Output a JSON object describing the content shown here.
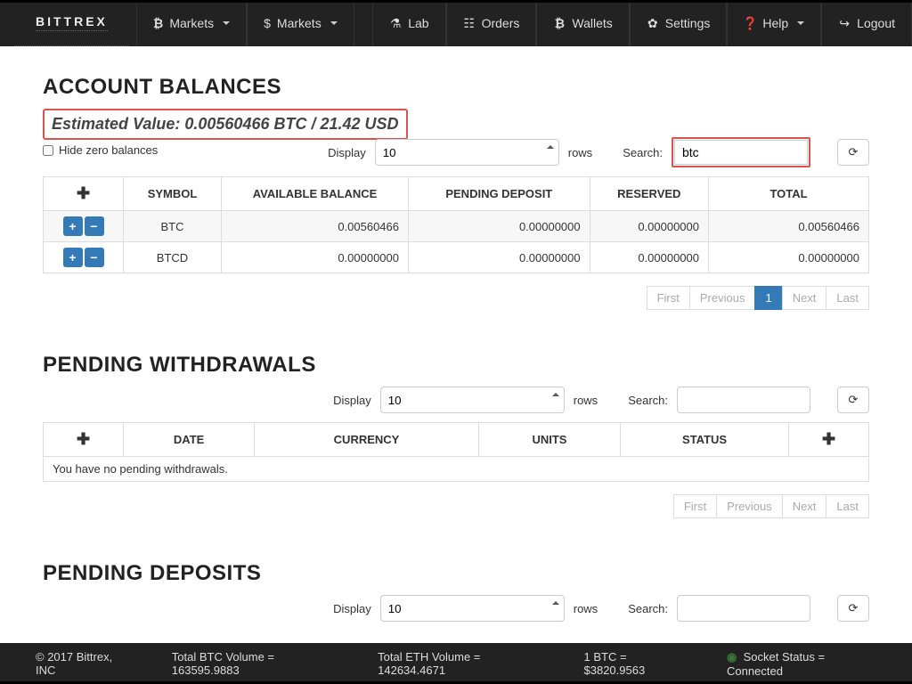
{
  "nav": {
    "brand": "BITTREX",
    "bmarkets": "₿ Markets",
    "dmarkets": "$ Markets",
    "lab": "Lab",
    "orders": "Orders",
    "wallets": "Wallets",
    "settings": "Settings",
    "help": "Help",
    "logout": "Logout"
  },
  "balances": {
    "title": "ACCOUNT BALANCES",
    "estimated": "Estimated Value: 0.00560466 BTC / 21.42 USD",
    "hidezero": "Hide zero balances",
    "display_label": "Display",
    "display_value": "10",
    "rows_label": "rows",
    "search_label": "Search:",
    "search_value": "btc",
    "headers": {
      "plus": "✚",
      "symbol": "SYMBOL",
      "avail": "AVAILABLE BALANCE",
      "pending": "PENDING DEPOSIT",
      "reserved": "RESERVED",
      "total": "TOTAL"
    },
    "rows": [
      {
        "symbol": "BTC",
        "avail": "0.00560466",
        "pending": "0.00000000",
        "reserved": "0.00000000",
        "total": "0.00560466"
      },
      {
        "symbol": "BTCD",
        "avail": "0.00000000",
        "pending": "0.00000000",
        "reserved": "0.00000000",
        "total": "0.00000000"
      }
    ],
    "pager": {
      "first": "First",
      "prev": "Previous",
      "page": "1",
      "next": "Next",
      "last": "Last"
    }
  },
  "withdrawals": {
    "title": "PENDING WITHDRAWALS",
    "display_label": "Display",
    "display_value": "10",
    "rows_label": "rows",
    "search_label": "Search:",
    "search_value": "",
    "headers": {
      "plus": "✚",
      "date": "DATE",
      "currency": "CURRENCY",
      "units": "UNITS",
      "status": "STATUS",
      "plus2": "✚"
    },
    "empty": "You have no pending withdrawals.",
    "pager": {
      "first": "First",
      "prev": "Previous",
      "next": "Next",
      "last": "Last"
    }
  },
  "deposits": {
    "title": "PENDING DEPOSITS",
    "display_label": "Display",
    "display_value": "10",
    "rows_label": "rows",
    "search_label": "Search:",
    "search_value": ""
  },
  "footer": {
    "copyright": "© 2017 Bittrex, INC",
    "btcvol": "Total BTC Volume = 163595.9883",
    "ethvol": "Total ETH Volume = 142634.4671",
    "rate": "1 BTC = $3820.9563",
    "socket": "Socket Status = Connected"
  }
}
